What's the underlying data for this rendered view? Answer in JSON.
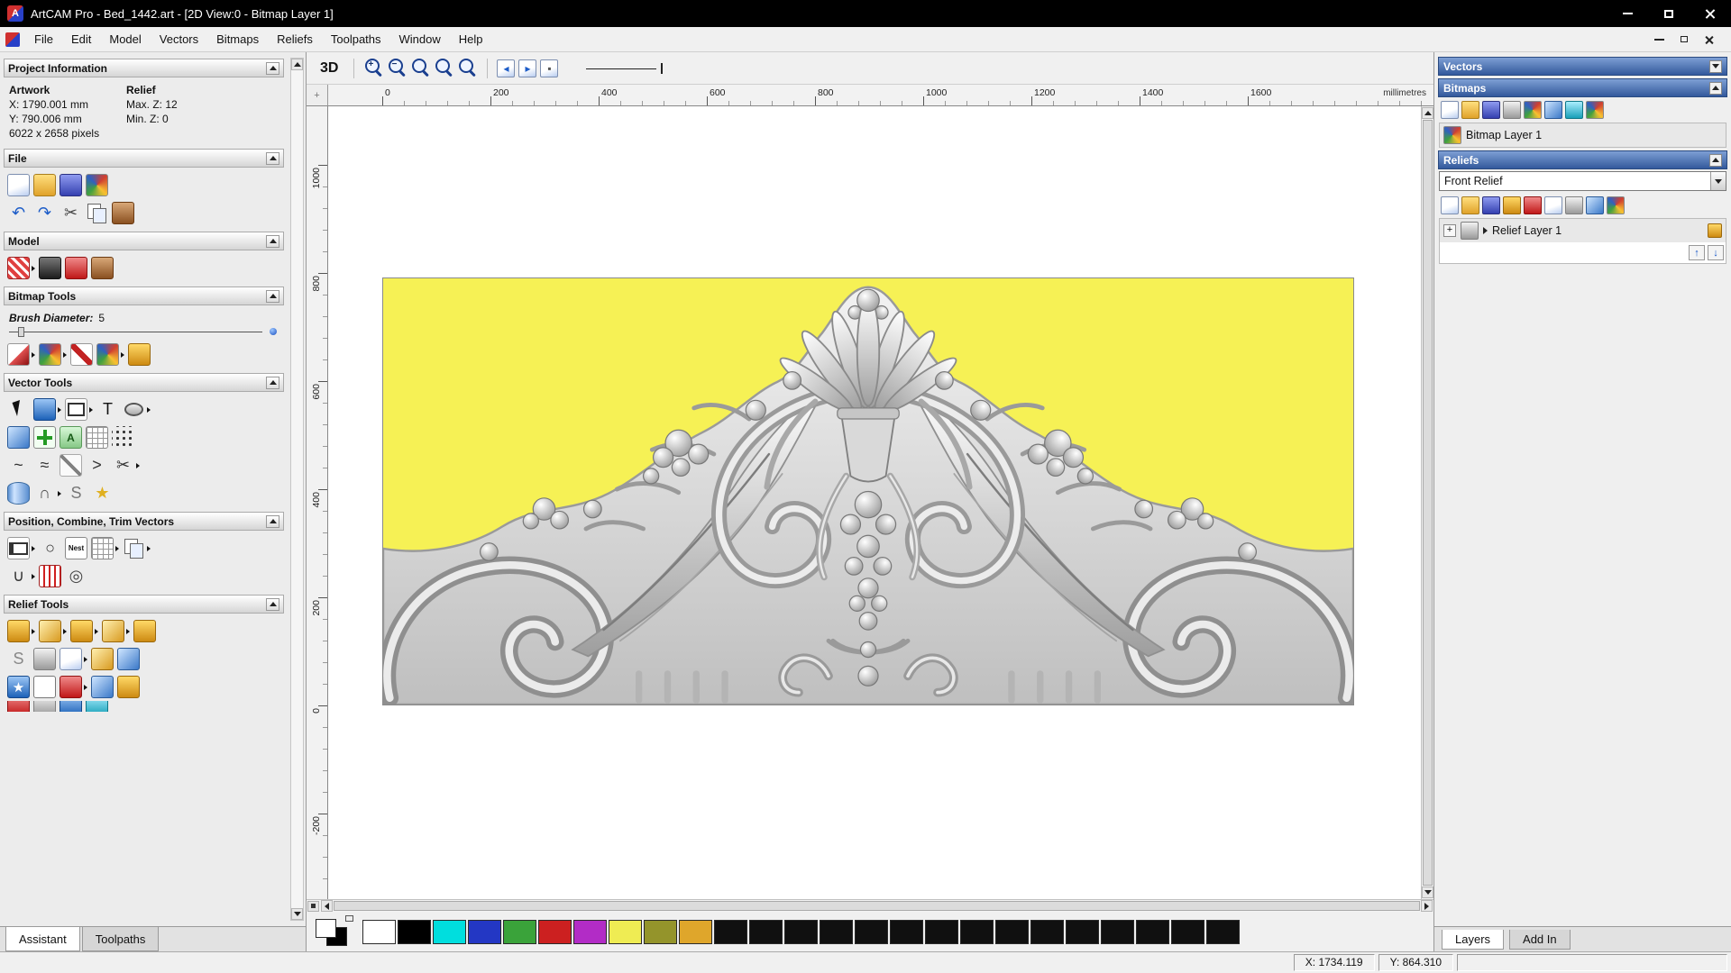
{
  "colors": {
    "header_blue": "#33599c",
    "artwork_yellow": "#f6f155",
    "titlebar_black": "#000000"
  },
  "titlebar": {
    "title": "ArtCAM Pro - Bed_1442.art - [2D View:0 - Bitmap Layer 1]",
    "app_icon_glyph": "A"
  },
  "menubar": {
    "items": [
      {
        "name": "menu-file",
        "label": "File"
      },
      {
        "name": "menu-edit",
        "label": "Edit"
      },
      {
        "name": "menu-model",
        "label": "Model"
      },
      {
        "name": "menu-vectors",
        "label": "Vectors"
      },
      {
        "name": "menu-bitmaps",
        "label": "Bitmaps"
      },
      {
        "name": "menu-reliefs",
        "label": "Reliefs"
      },
      {
        "name": "menu-toolpaths",
        "label": "Toolpaths"
      },
      {
        "name": "menu-window",
        "label": "Window"
      },
      {
        "name": "menu-help",
        "label": "Help"
      }
    ]
  },
  "left_panel": {
    "project_information": {
      "title": "Project Information",
      "col1_header": "Artwork",
      "col2_header": "Relief",
      "x": "X: 1790.001 mm",
      "y": "Y: 790.006 mm",
      "pixels": "6022 x 2658 pixels",
      "max_z": "Max. Z: 12",
      "min_z": "Min. Z: 0"
    },
    "file_section": {
      "title": "File",
      "row1": [
        {
          "name": "new-model-icon",
          "cls": "g-doc"
        },
        {
          "name": "open-model-icon",
          "cls": "g-folder"
        },
        {
          "name": "save-model-icon",
          "cls": "g-save"
        },
        {
          "name": "import-model-icon",
          "cls": "g-multi"
        }
      ],
      "row2": [
        {
          "name": "undo-icon",
          "cls": "g-plain",
          "glyph": "↶",
          "fg": "#1c5cc8"
        },
        {
          "name": "redo-icon",
          "cls": "g-plain",
          "glyph": "↷",
          "fg": "#1c5cc8"
        },
        {
          "name": "cut-icon",
          "cls": "g-plain",
          "glyph": "✂",
          "fg": "#444444"
        },
        {
          "name": "copy-icon",
          "cls": "i-copy"
        },
        {
          "name": "paste-icon",
          "cls": "g-brown"
        }
      ]
    },
    "model_section": {
      "title": "Model",
      "row1": [
        {
          "name": "lighting-material-icon",
          "cls": "g-redpat",
          "arrow": true
        },
        {
          "name": "texture-icon",
          "cls": "g-dark"
        },
        {
          "name": "sculpting-icon",
          "cls": "g-red"
        },
        {
          "name": "picture-icon",
          "cls": "g-brown"
        }
      ]
    },
    "bitmap_section": {
      "title": "Bitmap Tools",
      "brush_label": "Brush Diameter:",
      "brush_value": "5",
      "row1": [
        {
          "name": "paint-icon",
          "cls": "g-paint",
          "arrow": true
        },
        {
          "name": "colour-blend-icon",
          "cls": "g-multi",
          "arrow": true
        },
        {
          "name": "colour-picker-icon",
          "cls": "i-dropper"
        },
        {
          "name": "palette-icon",
          "cls": "g-multi",
          "arrow": true
        },
        {
          "name": "flood-fill-icon",
          "cls": "g-gold"
        }
      ]
    },
    "vector_section": {
      "title": "Vector Tools",
      "row1": [
        {
          "name": "select-vectors-icon",
          "cls": "i-cursor"
        },
        {
          "name": "transform-vectors-icon",
          "cls": "g-blue",
          "arrow": true
        },
        {
          "name": "create-rectangle-icon",
          "cls": "i-rect",
          "arrow": true
        },
        {
          "name": "create-text-icon",
          "cls": "g-plain",
          "glyph": "T",
          "fg": "#111111"
        },
        {
          "name": "create-ellipse-icon",
          "cls": "i-ellipse",
          "arrow": true
        }
      ],
      "row2": [
        {
          "name": "offset-vectors-icon",
          "cls": "g-blue2"
        },
        {
          "name": "create-polyline-icon",
          "cls": "i-plus"
        },
        {
          "name": "text-on-curve-icon",
          "cls": "i-abc",
          "glyph": "A"
        },
        {
          "name": "snap-grid-icon",
          "cls": "i-grid"
        },
        {
          "name": "point-array-icon",
          "cls": "i-dots"
        }
      ],
      "row3": [
        {
          "name": "fit-curve-icon",
          "cls": "g-plain",
          "glyph": "~",
          "fg": "#333333"
        },
        {
          "name": "smooth-polyline-icon",
          "cls": "g-plain",
          "glyph": "≈",
          "fg": "#333333"
        },
        {
          "name": "node-editing-icon",
          "cls": "i-node"
        },
        {
          "name": "arc-tool-icon",
          "cls": "g-plain",
          "glyph": ">",
          "fg": "#333333"
        },
        {
          "name": "vector-doctor-icon",
          "cls": "g-plain",
          "glyph": "✂",
          "fg": "#333333",
          "arrow": true
        }
      ],
      "row4": [
        {
          "name": "extrude-vector-icon",
          "cls": "i-cyl"
        },
        {
          "name": "weave-wizard-icon",
          "cls": "g-plain",
          "glyph": "∩",
          "fg": "#555555",
          "arrow": true
        },
        {
          "name": "pipe-wizard-icon",
          "cls": "g-plain",
          "glyph": "S",
          "fg": "#777777"
        },
        {
          "name": "star-wizard-icon",
          "cls": "g-plain",
          "glyph": "★",
          "fg": "#e0b020"
        }
      ]
    },
    "position_section": {
      "title": "Position, Combine, Trim Vectors",
      "row1": [
        {
          "name": "align-vectors-icon",
          "cls": "i-align",
          "arrow": true
        },
        {
          "name": "circular-copy-icon",
          "cls": "g-plain",
          "glyph": "○",
          "fg": "#333333"
        },
        {
          "name": "nesting-icon",
          "cls": "i-nest",
          "glyph": "Nest"
        },
        {
          "name": "block-copy-icon",
          "cls": "i-grid",
          "arrow": true
        },
        {
          "name": "group-vectors-icon",
          "cls": "i-copy",
          "arrow": true
        }
      ],
      "row2": [
        {
          "name": "join-vectors-icon",
          "cls": "g-plain",
          "glyph": "∪",
          "fg": "#333333",
          "arrow": true
        },
        {
          "name": "trim-vectors-icon",
          "cls": "g-redgrid"
        },
        {
          "name": "spiral-icon",
          "cls": "g-plain",
          "glyph": "◎",
          "fg": "#444444"
        }
      ]
    },
    "relief_section": {
      "title": "Relief Tools",
      "row1": [
        {
          "name": "shape-editor-icon",
          "cls": "g-gold",
          "arrow": true
        },
        {
          "name": "smooth-relief-icon",
          "cls": "g-gold2",
          "arrow": true
        },
        {
          "name": "sculpting-relief-icon",
          "cls": "g-gold",
          "arrow": true
        },
        {
          "name": "spin-relief-icon",
          "cls": "g-gold2",
          "arrow": true
        },
        {
          "name": "turn-relief-icon",
          "cls": "g-gold"
        }
      ],
      "row2": [
        {
          "name": "swept-profiles-icon",
          "cls": "g-plain",
          "glyph": "S",
          "fg": "#888888"
        },
        {
          "name": "weave-relief-icon",
          "cls": "g-gray"
        },
        {
          "name": "greyscale-relief-icon",
          "cls": "g-doc",
          "arrow": true
        },
        {
          "name": "isolate-relief-icon",
          "cls": "g-gold2"
        },
        {
          "name": "lock-relief-icon",
          "cls": "g-blue2"
        }
      ],
      "row3": [
        {
          "name": "star-relief-icon",
          "cls": "g-blue",
          "glyph": "★",
          "fg": "#ffffff"
        },
        {
          "name": "envelope-relief-icon",
          "cls": "g-white"
        },
        {
          "name": "fan-relief-icon",
          "cls": "g-red",
          "arrow": true
        },
        {
          "name": "texture-relief-icon",
          "cls": "g-blue2"
        },
        {
          "name": "offset-relief-icon",
          "cls": "g-gold"
        }
      ],
      "row4": [
        {
          "name": "relief-tool-icon",
          "cls": "g-red"
        },
        {
          "name": "relief-tool-icon",
          "cls": "g-gray"
        },
        {
          "name": "relief-tool-icon",
          "cls": "g-blue"
        },
        {
          "name": "relief-tool-icon",
          "cls": "g-teal"
        }
      ]
    },
    "tabs": [
      {
        "name": "tab-assistant",
        "label": "Assistant",
        "active": true
      },
      {
        "name": "tab-toolpaths",
        "label": "Toolpaths"
      }
    ]
  },
  "toolbar": {
    "view_3d_label": "3D",
    "zoom_tools": [
      {
        "name": "zoom-in-icon",
        "glyph": "+"
      },
      {
        "name": "zoom-out-icon",
        "glyph": "−"
      },
      {
        "name": "zoom-previous-icon",
        "glyph": ""
      },
      {
        "name": "zoom-fit-icon",
        "glyph": ""
      },
      {
        "name": "zoom-objects-icon",
        "glyph": ""
      }
    ],
    "view_tools": [
      {
        "name": "previous-view-icon",
        "cls": "g-doc",
        "glyph": "◂",
        "fg": "#1c5cc8"
      },
      {
        "name": "next-view-icon",
        "cls": "g-doc",
        "glyph": "▸",
        "fg": "#1c5cc8"
      },
      {
        "name": "redraw-view-icon",
        "cls": "g-doc",
        "glyph": "▪",
        "fg": "#555555"
      }
    ]
  },
  "ruler": {
    "h_labels": [
      "0",
      "200",
      "400",
      "600",
      "800",
      "1000",
      "1200",
      "1400",
      "1600"
    ],
    "v_labels": [
      "1000",
      "800",
      "600",
      "400",
      "200",
      "0",
      "-200"
    ],
    "units": "millimetres"
  },
  "canvas": {
    "artwork_bg": "#f6f155"
  },
  "palette": {
    "dual": {
      "front": "#ffffff",
      "back": "#000000"
    },
    "swatches": [
      {
        "name": "swatch-white",
        "color": "#ffffff"
      },
      {
        "name": "swatch-black",
        "color": "#000000"
      },
      {
        "name": "swatch-cyan",
        "color": "#00dede"
      },
      {
        "name": "swatch-blue",
        "color": "#2337c4"
      },
      {
        "name": "swatch-green",
        "color": "#3aa33a"
      },
      {
        "name": "swatch-red",
        "color": "#cc2020"
      },
      {
        "name": "swatch-magenta",
        "color": "#b22cc6"
      },
      {
        "name": "swatch-yellow",
        "color": "#efec53"
      },
      {
        "name": "swatch-olive",
        "color": "#94942b"
      },
      {
        "name": "swatch-gold",
        "color": "#dfa62b"
      },
      {
        "name": "swatch-dark",
        "color": "#101010"
      },
      {
        "name": "swatch-dark",
        "color": "#101010"
      },
      {
        "name": "swatch-dark",
        "color": "#101010"
      },
      {
        "name": "swatch-dark",
        "color": "#101010"
      },
      {
        "name": "swatch-dark",
        "color": "#101010"
      },
      {
        "name": "swatch-dark",
        "color": "#101010"
      },
      {
        "name": "swatch-dark",
        "color": "#101010"
      },
      {
        "name": "swatch-dark",
        "color": "#101010"
      },
      {
        "name": "swatch-dark",
        "color": "#101010"
      },
      {
        "name": "swatch-dark",
        "color": "#101010"
      },
      {
        "name": "swatch-dark",
        "color": "#101010"
      },
      {
        "name": "swatch-dark",
        "color": "#101010"
      },
      {
        "name": "swatch-dark",
        "color": "#101010"
      },
      {
        "name": "swatch-dark",
        "color": "#101010"
      },
      {
        "name": "swatch-dark",
        "color": "#101010"
      }
    ]
  },
  "right_panel": {
    "vectors": {
      "title": "Vectors"
    },
    "bitmaps": {
      "title": "Bitmaps",
      "layer_name": "Bitmap Layer 1",
      "tools": [
        {
          "name": "new-bitmap-layer-icon",
          "cls": "g-doc"
        },
        {
          "name": "open-bitmap-layer-icon",
          "cls": "g-folder"
        },
        {
          "name": "save-bitmap-layer-icon",
          "cls": "g-save"
        },
        {
          "name": "merge-layers-icon",
          "cls": "g-gray"
        },
        {
          "name": "colour-reduce-icon",
          "cls": "g-multi"
        },
        {
          "name": "link-colours-icon",
          "cls": "g-blue2"
        },
        {
          "name": "transparency-icon",
          "cls": "g-teal"
        },
        {
          "name": "layer-properties-icon",
          "cls": "g-multi"
        }
      ]
    },
    "reliefs": {
      "title": "Reliefs",
      "combo_value": "Front Relief",
      "layer_name": "Relief Layer 1",
      "tools": [
        {
          "name": "new-relief-layer-icon",
          "cls": "g-doc"
        },
        {
          "name": "open-relief-layer-icon",
          "cls": "g-folder"
        },
        {
          "name": "save-relief-layer-icon",
          "cls": "g-save"
        },
        {
          "name": "smooth-layer-icon",
          "cls": "g-gold"
        },
        {
          "name": "invert-layer-icon",
          "cls": "g-red"
        },
        {
          "name": "scale-layer-icon",
          "cls": "g-doc"
        },
        {
          "name": "calculate-layer-icon",
          "cls": "g-gray"
        },
        {
          "name": "delete-layer-icon",
          "cls": "g-blue2"
        },
        {
          "name": "layer-properties-icon",
          "cls": "g-multi"
        }
      ]
    },
    "tabs": [
      {
        "name": "tab-layers",
        "label": "Layers",
        "active": true
      },
      {
        "name": "tab-add-in",
        "label": "Add In"
      }
    ]
  },
  "statusbar": {
    "x": "X: 1734.119",
    "y": "Y: 864.310"
  }
}
